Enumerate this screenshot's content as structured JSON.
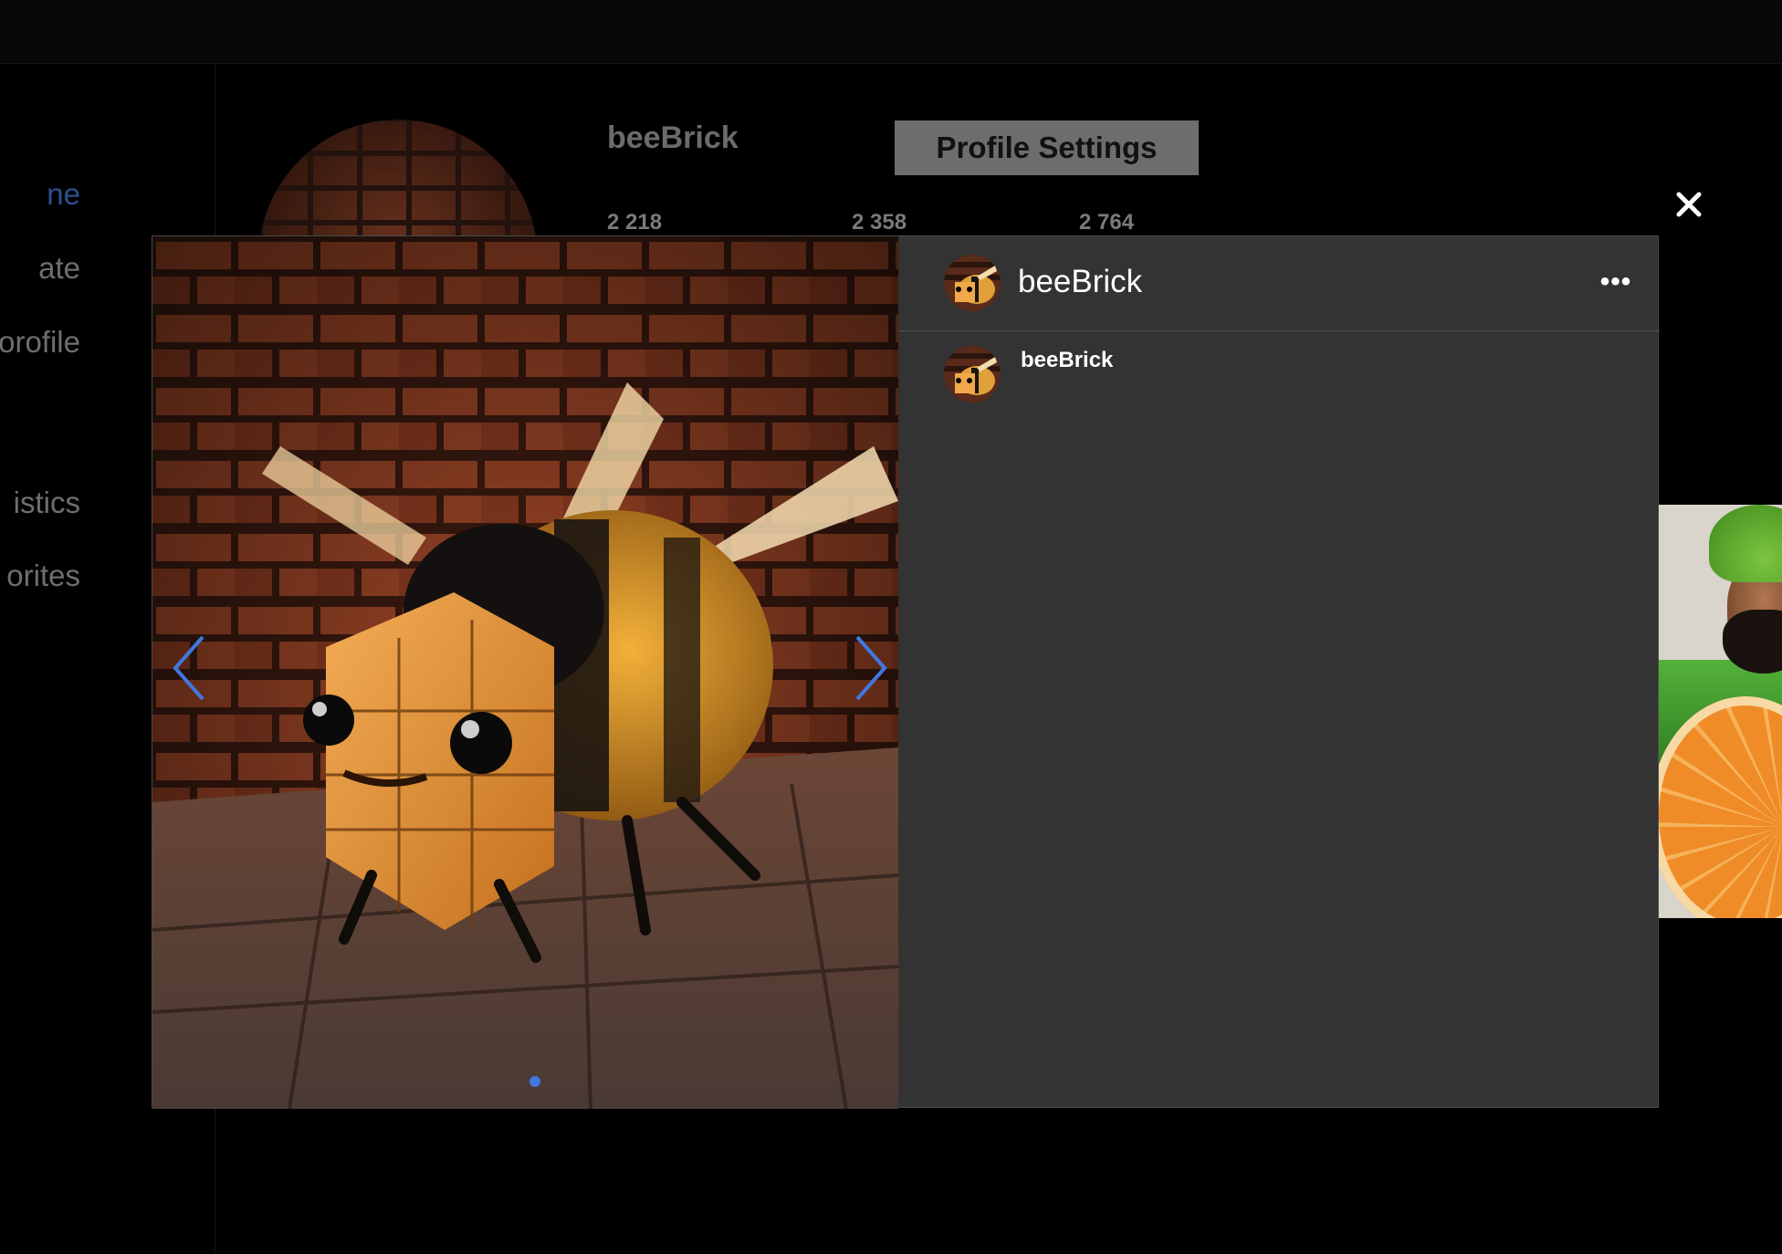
{
  "sidebar": {
    "items": [
      {
        "label": "ne",
        "active": true
      },
      {
        "label": "ate",
        "active": false
      },
      {
        "label": "orofile",
        "active": false
      },
      {
        "label": "istics",
        "active": false
      },
      {
        "label": "orites",
        "active": false
      }
    ]
  },
  "profile": {
    "username": "beeBrick",
    "settings_button": "Profile Settings",
    "stats": [
      "2 218",
      "2 358",
      "2 764"
    ]
  },
  "modal": {
    "close_icon": "close-icon",
    "post": {
      "username": "beeBrick",
      "more_icon": "ellipsis-icon",
      "more_label": "•••",
      "image_icon": "brick-bee-image"
    },
    "comments": [
      {
        "username": "beeBrick"
      }
    ],
    "carousel": {
      "prev_icon": "chevron-left-icon",
      "next_icon": "chevron-right-icon",
      "slide_count": 1,
      "active_slide": 1
    }
  },
  "colors": {
    "accent": "#3f78e0",
    "modal_bg": "#333333",
    "page_bg": "#000000",
    "settings_button_bg": "#6d6d6d"
  }
}
